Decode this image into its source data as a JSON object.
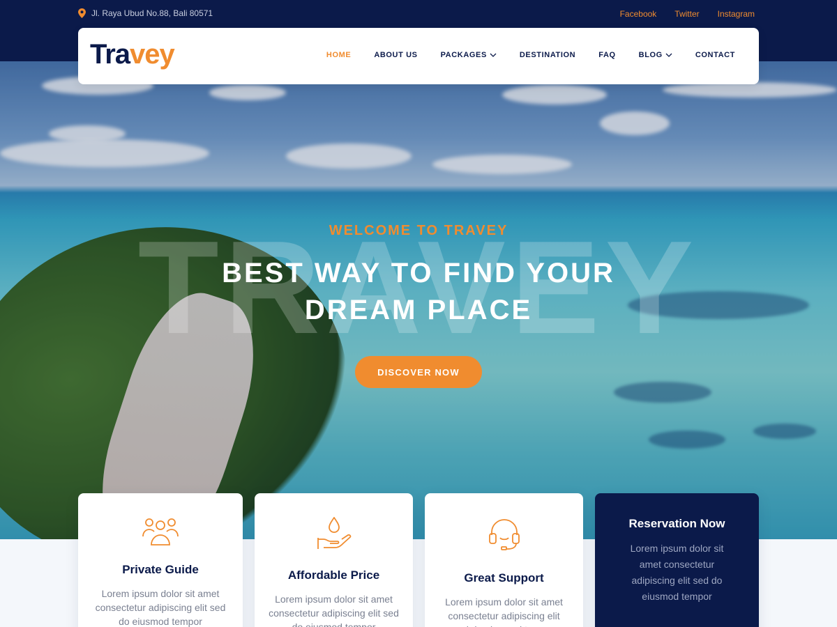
{
  "topbar": {
    "address": "Jl. Raya Ubud No.88, Bali 80571",
    "social": [
      "Facebook",
      "Twitter",
      "Instagram"
    ]
  },
  "brand": {
    "part1": "Tra",
    "part2": "vey"
  },
  "nav": {
    "items": [
      {
        "label": "HOME",
        "active": true
      },
      {
        "label": "ABOUT US"
      },
      {
        "label": "PACKAGES",
        "dropdown": true
      },
      {
        "label": "DESTINATION"
      },
      {
        "label": "FAQ"
      },
      {
        "label": "BLOG",
        "dropdown": true
      },
      {
        "label": "CONTACT"
      }
    ]
  },
  "hero": {
    "watermark": "TRAVEY",
    "eyebrow": "WELCOME TO TRAVEY",
    "headline_line1": "BEST WAY TO FIND YOUR",
    "headline_line2": "DREAM PLACE",
    "cta": "DISCOVER NOW"
  },
  "features": [
    {
      "icon": "users-group-icon",
      "title": "Private Guide",
      "text": "Lorem ipsum dolor sit amet consectetur adipiscing elit sed do eiusmod tempor"
    },
    {
      "icon": "hand-drop-icon",
      "title": "Affordable Price",
      "text": "Lorem ipsum dolor sit amet consectetur adipiscing elit sed do eiusmod tempor"
    },
    {
      "icon": "headset-icon",
      "title": "Great Support",
      "text": "Lorem ipsum dolor sit amet consectetur adipiscing elit sed do eiusmod tempor"
    }
  ],
  "reservation": {
    "title": "Reservation Now",
    "text": "Lorem ipsum dolor sit amet consectetur adipiscing elit sed do eiusmod tempor"
  },
  "colors": {
    "navy": "#0b1a4a",
    "accent": "#f08c2f"
  }
}
